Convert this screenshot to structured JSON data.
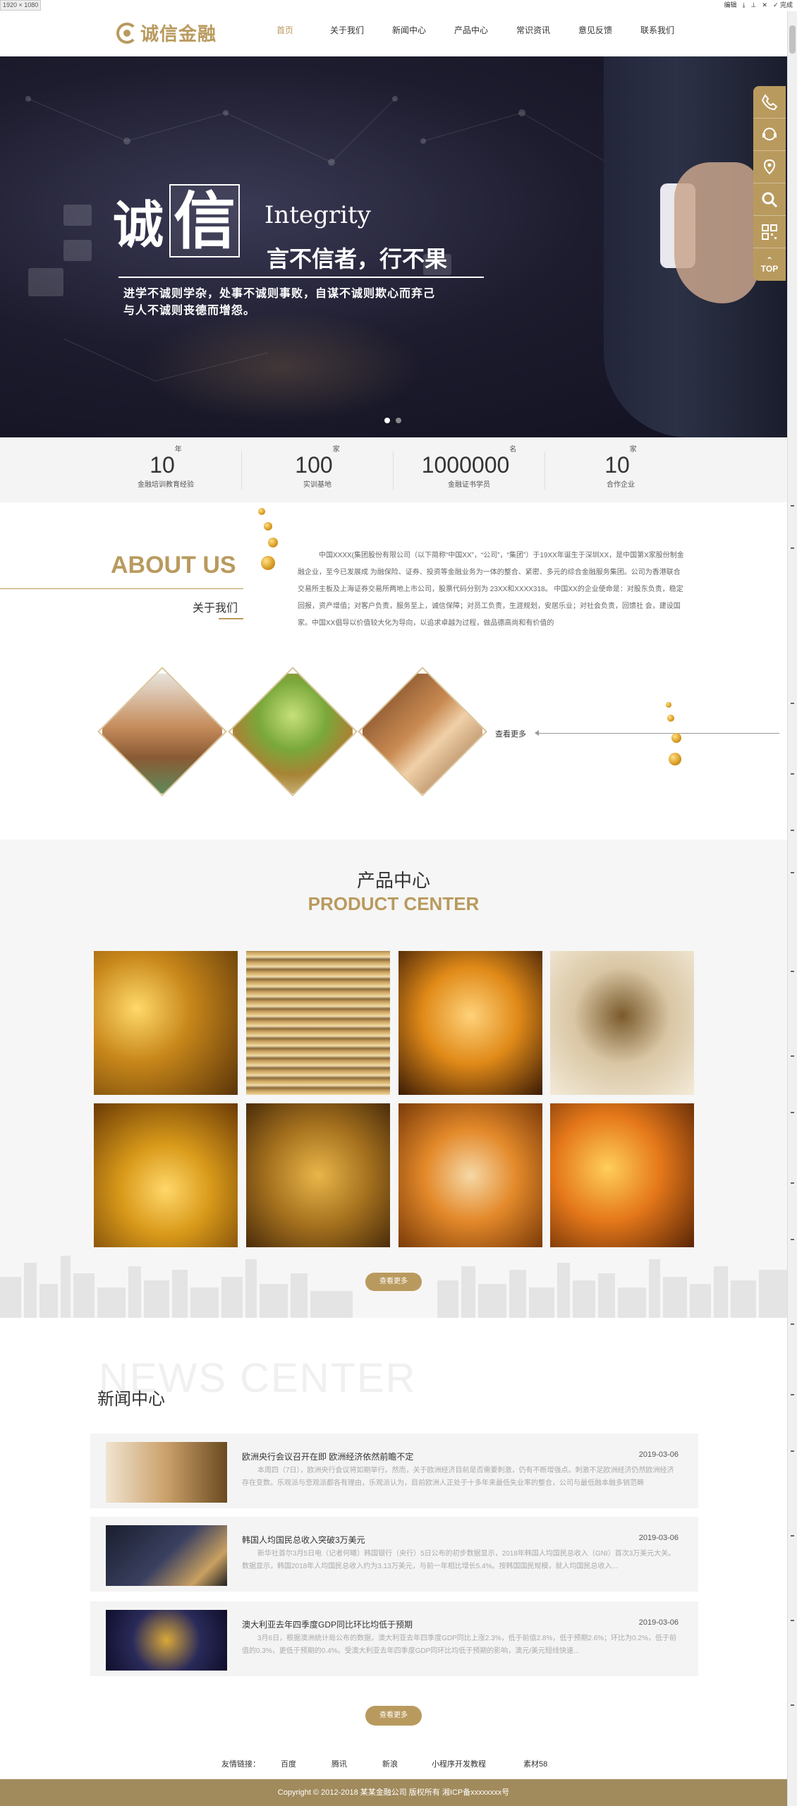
{
  "editor": {
    "size_tag": "1920 × 1080",
    "edit": "编辑",
    "done": "完成"
  },
  "header": {
    "logo_text": "诚信金融",
    "nav": [
      "首页",
      "关于我们",
      "新闻中心",
      "产品中心",
      "常识资讯",
      "意见反馈",
      "联系我们"
    ]
  },
  "banner": {
    "char1": "诚",
    "char2": "信",
    "en": "Integrity",
    "sub": "言不信者，行不果",
    "line1": "进学不诚则学杂，处事不诚则事败，自谋不诚则欺心而弃己",
    "line2": "与人不诚则丧德而增怨。"
  },
  "floatbar": {
    "top_label": "TOP"
  },
  "stats": [
    {
      "num": "10",
      "unit": "年",
      "label": "金融培训教育经验"
    },
    {
      "num": "100",
      "unit": "家",
      "label": "实训基地"
    },
    {
      "num": "1000000",
      "unit": "名",
      "label": "金融证书学员"
    },
    {
      "num": "10",
      "unit": "家",
      "label": "合作企业"
    }
  ],
  "about": {
    "title_en": "ABOUT US",
    "title_cn": "关于我们",
    "text": "中国XXXX(集团股份有限公司（以下简称“中国XX”，“公司”，“集团”）于19XX年诞生于深圳XX，是中国第X家股份制金融企业，至今已发展成 为融保险、证券、投资等金融业务为一体的整合、紧密、多元的综合金融服务集团。公司为香港联合交易所主板及上海证券交易所两地上市公司，股票代码分别为 23XX和XXXX318。    中国XX的企业使命是：对股东负责，稳定回报，资产增值；对客户负责，服务至上，诚信保障；对员工负责，生涯规划，安居乐业；对社会负责，回馈社 会，建设国家。中国XX倡导以价值较大化为导向，以追求卓越为过程，做品德高尚和有价值的",
    "more": "查看更多"
  },
  "products": {
    "title_cn": "产品中心",
    "title_en": "PRODUCT CENTER",
    "more": "查看更多"
  },
  "news": {
    "bg_word": "NEWS CENTER",
    "title": "新闻中心",
    "items": [
      {
        "title": "欧洲央行会议召开在即 欧洲经济依然前瞻不定",
        "date": "2019-03-06",
        "summary": "本周四（7日），欧洲央行会议将如期举行。然而，关于欧洲经济目前是否需要刺激，仍有不断增强点。刺激不足欧洲经济仍然欧洲经济存在变数。乐观派与悲观派都各有理由，乐观派认为，目前欧洲人正处于十多年来最低失业率的整合，公司与最低融本融多销范畴"
      },
      {
        "title": "韩国人均国民总收入突破3万美元",
        "date": "2019-03-06",
        "summary": "新华社首尔3月5日电（记者何曦）韩国银行（央行）5日公布的初步数据显示，2018年韩国人均国民总收入（GNI）首次3万美元大关。数据显示，韩国2018年人均国民总收入约为3.13万美元，与前一年相比增长5.4%。按韩国国民规模，就人均国民总收入..."
      },
      {
        "title": "澳大利亚去年四季度GDP同比环比均低于预期",
        "date": "2019-03-06",
        "summary": "3月6日，根据澳洲统计局公布的数据，澳大利亚去年四季度GDP同比上涨2.3%，低于前值2.8%，低于预期2.6%；环比为0.2%，低于前值的0.3%，更低于预期的0.4%。受澳大利亚去年四季度GDP同环比均低于预期的影响，澳元/美元短线快速..."
      }
    ],
    "more": "查看更多"
  },
  "friend_links": {
    "label": "友情链接：",
    "links": [
      "百度",
      "腾讯",
      "新浪",
      "小程序开发教程",
      "素材58"
    ]
  },
  "footer": {
    "copyright": "Copyright © 2012-2018 某某金融公司 版权所有    湘ICP备xxxxxxxx号"
  },
  "colors": {
    "accent": "#b99a5e",
    "footer": "#a18a5c",
    "banner_dark": "#1d1c2e"
  }
}
